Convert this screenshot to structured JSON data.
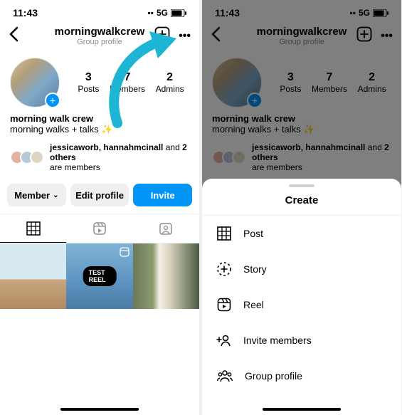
{
  "statusbar": {
    "time": "11:43",
    "network": "5G"
  },
  "header": {
    "title": "morningwalkcrew",
    "subtitle": "Group profile"
  },
  "stats": {
    "posts_n": "3",
    "posts_l": "Posts",
    "members_n": "7",
    "members_l": "Members",
    "admins_n": "2",
    "admins_l": "Admins"
  },
  "bio": {
    "name": "morning walk crew",
    "text": "morning walks + talks ✨"
  },
  "members_line_pre": "jessicaworb, hannahmcinall",
  "members_line_mid": " and ",
  "members_line_bold": "2 others",
  "members_line_post": " are members",
  "buttons": {
    "member": "Member",
    "edit": "Edit profile",
    "invite": "Invite"
  },
  "grid_badge": "TEST REEL",
  "sheet": {
    "title": "Create",
    "post": "Post",
    "story": "Story",
    "reel": "Reel",
    "invite": "Invite members",
    "group": "Group profile"
  }
}
